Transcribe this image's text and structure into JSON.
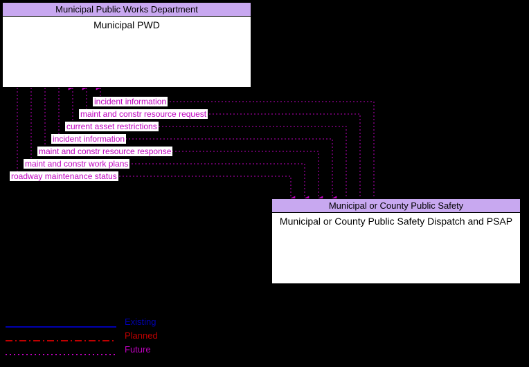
{
  "nodes": {
    "pwd": {
      "header": "Municipal Public Works Department",
      "body": "Municipal PWD"
    },
    "psap": {
      "header": "Municipal or County Public Safety",
      "body": "Municipal or County Public Safety Dispatch and PSAP"
    }
  },
  "flows": [
    "incident information",
    "maint and constr resource request",
    "current asset restrictions",
    "incident information",
    "maint and constr resource response",
    "maint and constr work plans",
    "roadway maintenance status"
  ],
  "legend": {
    "existing": "Existing",
    "planned": "Planned",
    "future": "Future"
  },
  "colors": {
    "future": "#c000c0",
    "existing": "#0000b0",
    "planned": "#c00000",
    "nodeHeader": "#c8a8f0"
  }
}
